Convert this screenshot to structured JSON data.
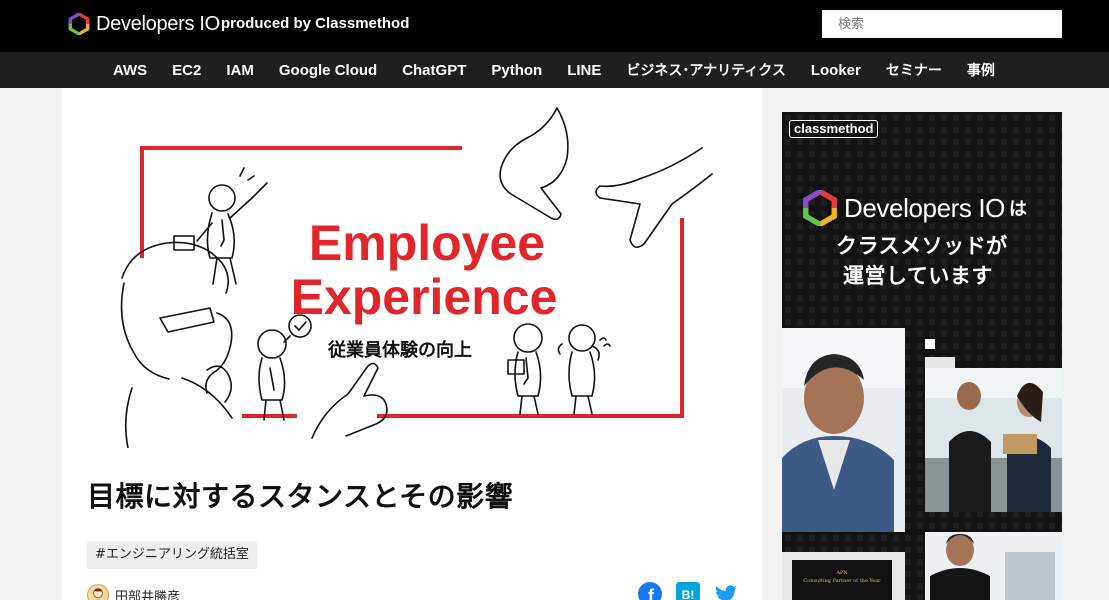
{
  "header": {
    "logo_text": "Developers IO",
    "tagline": "produced by Classmethod",
    "search_placeholder": "検索"
  },
  "nav": {
    "items": [
      "AWS",
      "EC2",
      "IAM",
      "Google Cloud",
      "ChatGPT",
      "Python",
      "LINE",
      "ビジネス･アナリティクス",
      "Looker",
      "セミナー",
      "事例"
    ]
  },
  "hero": {
    "line1": "Employee",
    "line2": "Experience",
    "subtitle": "従業員体験の向上"
  },
  "article": {
    "title": "目標に対するスタンスとその影響",
    "tag": "#エンジニアリング統括室",
    "author": "田部井勝彦"
  },
  "share": {
    "facebook": "f",
    "hatena": "B!"
  },
  "ad": {
    "brand": "classmethod",
    "logo_text": "Developers IO",
    "logo_suffix": "は",
    "line1": "クラスメソッドが",
    "line2": "運営しています",
    "plaque_line1": "APN",
    "plaque_line2": "Consulting Partner of the Year"
  },
  "colors": {
    "accent_red": "#e0262b",
    "header_bg": "#000000",
    "nav_bg": "#1f1f1f",
    "twitter": "#1d9bf0",
    "facebook": "#1877f2",
    "hatena": "#00a4de"
  }
}
